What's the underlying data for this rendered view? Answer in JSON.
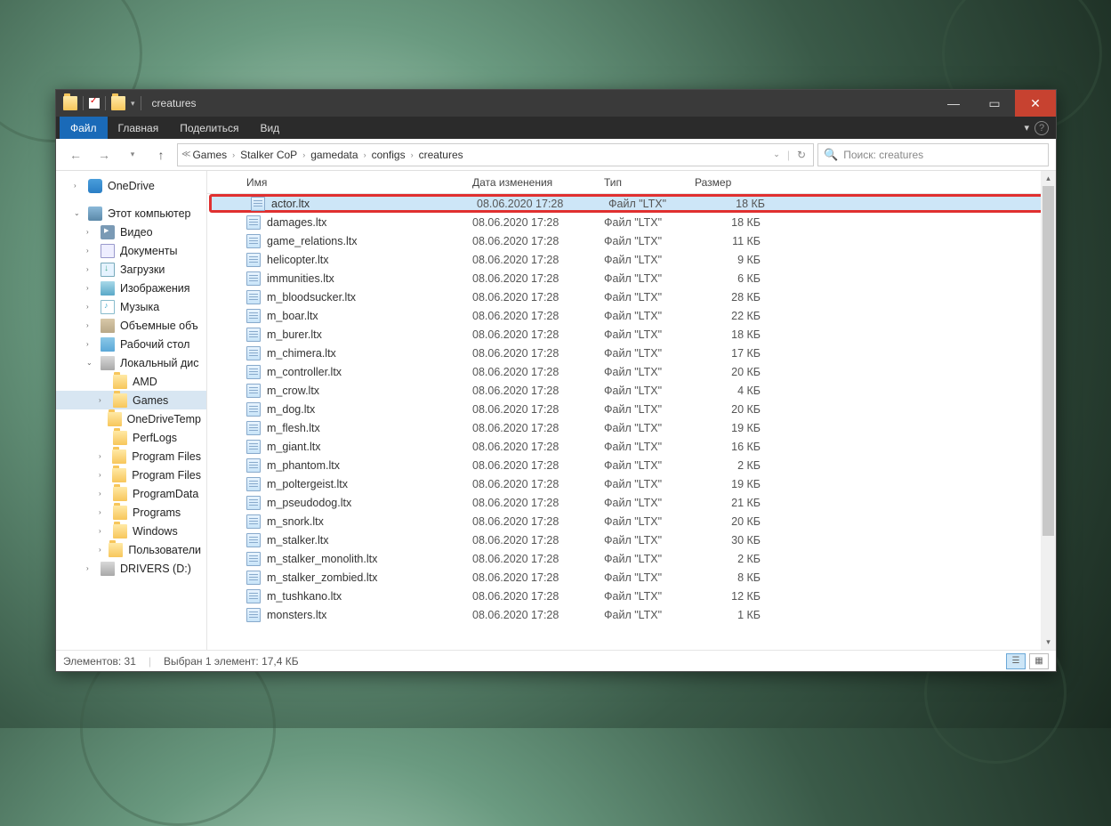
{
  "window": {
    "title": "creatures"
  },
  "tabs": {
    "file": "Файл",
    "home": "Главная",
    "share": "Поделиться",
    "view": "Вид"
  },
  "nav": {
    "breadcrumb": [
      "Games",
      "Stalker CoP",
      "gamedata",
      "configs",
      "creatures"
    ],
    "refresh_icon": "↻",
    "search_placeholder": "Поиск: creatures"
  },
  "sidebar": {
    "onedrive": "OneDrive",
    "thispc": "Этот компьютер",
    "videos": "Видео",
    "documents": "Документы",
    "downloads": "Загрузки",
    "images": "Изображения",
    "music": "Музыка",
    "objects3d": "Объемные объ",
    "desktop": "Рабочий стол",
    "localdisk": "Локальный дис",
    "amd": "AMD",
    "games": "Games",
    "onedrivetemp": "OneDriveTemp",
    "perflogs": "PerfLogs",
    "programfiles": "Program Files",
    "programfilesx": "Program Files",
    "programdata": "ProgramData",
    "programs": "Programs",
    "windows": "Windows",
    "users": "Пользователи",
    "driversd": "DRIVERS (D:)"
  },
  "columns": {
    "name": "Имя",
    "date": "Дата изменения",
    "type": "Тип",
    "size": "Размер"
  },
  "files": [
    {
      "name": "actor.ltx",
      "date": "08.06.2020 17:28",
      "type": "Файл \"LTX\"",
      "size": "18 КБ",
      "selected": true,
      "highlighted": true
    },
    {
      "name": "damages.ltx",
      "date": "08.06.2020 17:28",
      "type": "Файл \"LTX\"",
      "size": "18 КБ"
    },
    {
      "name": "game_relations.ltx",
      "date": "08.06.2020 17:28",
      "type": "Файл \"LTX\"",
      "size": "11 КБ"
    },
    {
      "name": "helicopter.ltx",
      "date": "08.06.2020 17:28",
      "type": "Файл \"LTX\"",
      "size": "9 КБ"
    },
    {
      "name": "immunities.ltx",
      "date": "08.06.2020 17:28",
      "type": "Файл \"LTX\"",
      "size": "6 КБ"
    },
    {
      "name": "m_bloodsucker.ltx",
      "date": "08.06.2020 17:28",
      "type": "Файл \"LTX\"",
      "size": "28 КБ"
    },
    {
      "name": "m_boar.ltx",
      "date": "08.06.2020 17:28",
      "type": "Файл \"LTX\"",
      "size": "22 КБ"
    },
    {
      "name": "m_burer.ltx",
      "date": "08.06.2020 17:28",
      "type": "Файл \"LTX\"",
      "size": "18 КБ"
    },
    {
      "name": "m_chimera.ltx",
      "date": "08.06.2020 17:28",
      "type": "Файл \"LTX\"",
      "size": "17 КБ"
    },
    {
      "name": "m_controller.ltx",
      "date": "08.06.2020 17:28",
      "type": "Файл \"LTX\"",
      "size": "20 КБ"
    },
    {
      "name": "m_crow.ltx",
      "date": "08.06.2020 17:28",
      "type": "Файл \"LTX\"",
      "size": "4 КБ"
    },
    {
      "name": "m_dog.ltx",
      "date": "08.06.2020 17:28",
      "type": "Файл \"LTX\"",
      "size": "20 КБ"
    },
    {
      "name": "m_flesh.ltx",
      "date": "08.06.2020 17:28",
      "type": "Файл \"LTX\"",
      "size": "19 КБ"
    },
    {
      "name": "m_giant.ltx",
      "date": "08.06.2020 17:28",
      "type": "Файл \"LTX\"",
      "size": "16 КБ"
    },
    {
      "name": "m_phantom.ltx",
      "date": "08.06.2020 17:28",
      "type": "Файл \"LTX\"",
      "size": "2 КБ"
    },
    {
      "name": "m_poltergeist.ltx",
      "date": "08.06.2020 17:28",
      "type": "Файл \"LTX\"",
      "size": "19 КБ"
    },
    {
      "name": "m_pseudodog.ltx",
      "date": "08.06.2020 17:28",
      "type": "Файл \"LTX\"",
      "size": "21 КБ"
    },
    {
      "name": "m_snork.ltx",
      "date": "08.06.2020 17:28",
      "type": "Файл \"LTX\"",
      "size": "20 КБ"
    },
    {
      "name": "m_stalker.ltx",
      "date": "08.06.2020 17:28",
      "type": "Файл \"LTX\"",
      "size": "30 КБ"
    },
    {
      "name": "m_stalker_monolith.ltx",
      "date": "08.06.2020 17:28",
      "type": "Файл \"LTX\"",
      "size": "2 КБ"
    },
    {
      "name": "m_stalker_zombied.ltx",
      "date": "08.06.2020 17:28",
      "type": "Файл \"LTX\"",
      "size": "8 КБ"
    },
    {
      "name": "m_tushkano.ltx",
      "date": "08.06.2020 17:28",
      "type": "Файл \"LTX\"",
      "size": "12 КБ"
    },
    {
      "name": "monsters.ltx",
      "date": "08.06.2020 17:28",
      "type": "Файл \"LTX\"",
      "size": "1 КБ"
    }
  ],
  "status": {
    "count": "Элементов: 31",
    "selection": "Выбран 1 элемент: 17,4 КБ"
  }
}
